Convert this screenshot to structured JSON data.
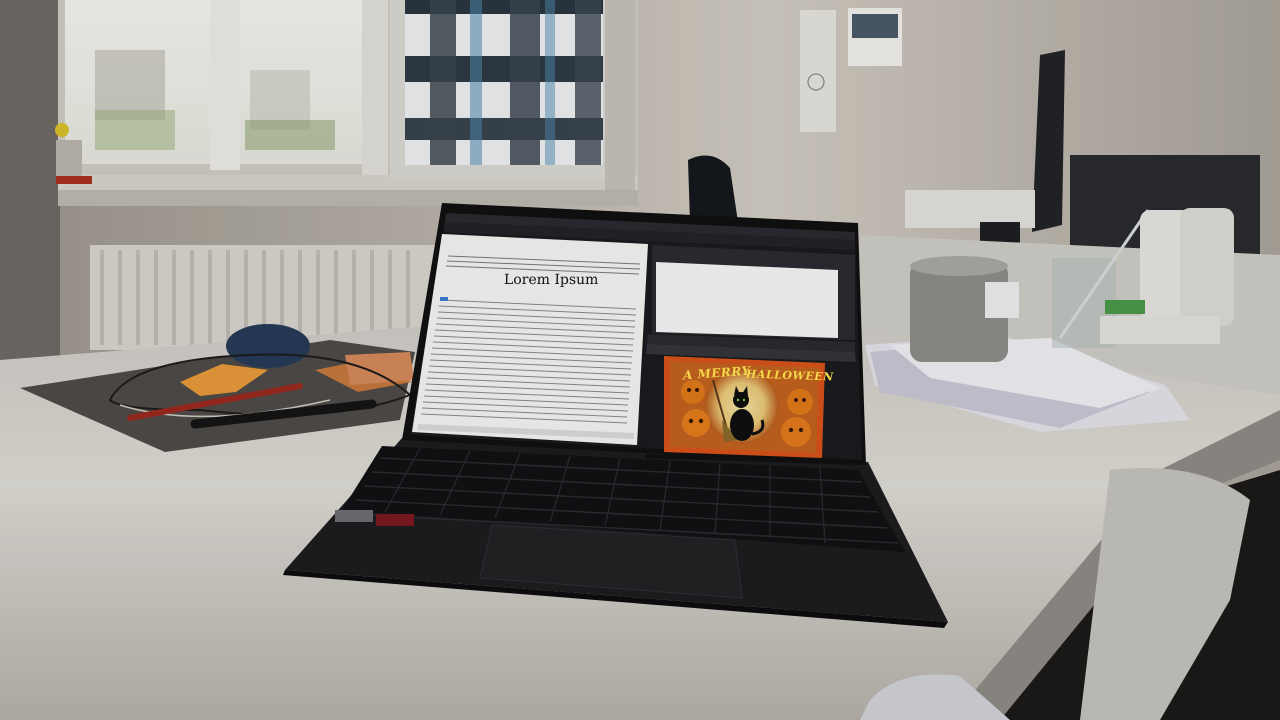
{
  "scene": {
    "colors": {
      "wall": "#d8d4cc",
      "desk": "#d9d6d0",
      "laptop": "#1c1c1f",
      "document": "#f4f4f2",
      "card_border": "#d8531a",
      "card_bg": "#c0621f",
      "cat": "#111111",
      "pumpkin": "#e07a1a"
    },
    "laptop_screen": {
      "document_heading": "Lorem Ipsum"
    },
    "halloween_card": {
      "line_left": "A MERRY",
      "line_right": "HALLOWEEN"
    }
  }
}
